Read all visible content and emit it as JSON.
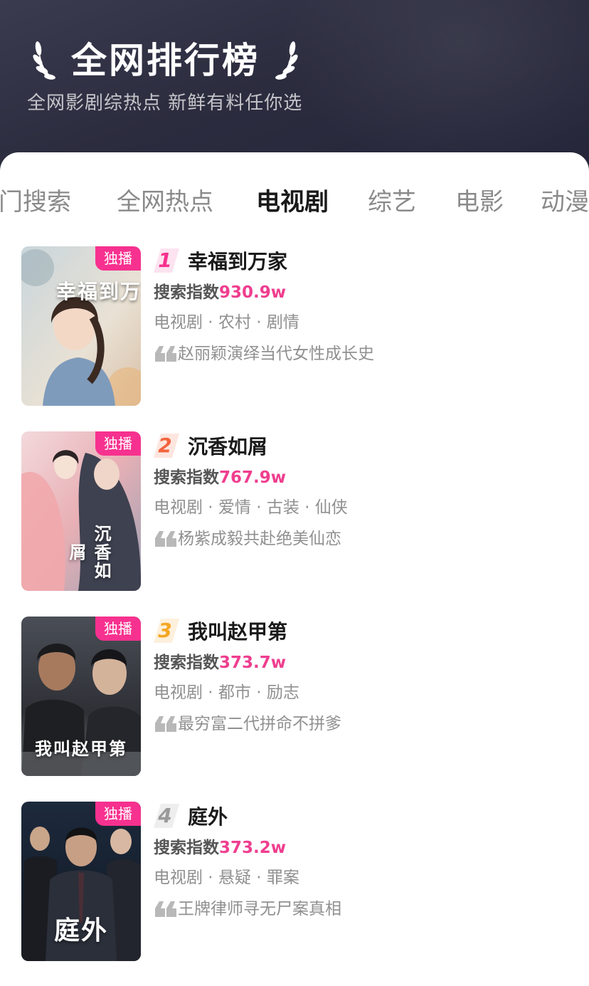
{
  "header": {
    "title": "全网排行榜",
    "subtitle": "全网影剧综热点  新鲜有料任你选"
  },
  "tabs": [
    {
      "label": "热门搜索",
      "active": false
    },
    {
      "label": "全网热点",
      "active": false
    },
    {
      "label": "电视剧",
      "active": true
    },
    {
      "label": "综艺",
      "active": false
    },
    {
      "label": "电影",
      "active": false
    },
    {
      "label": "动漫",
      "active": false
    }
  ],
  "search_prefix": "搜索指数",
  "items": [
    {
      "rank": "1",
      "rank_color": "#f7318f",
      "badge": "独播",
      "title": "幸福到万家",
      "search_index": "930.9w",
      "tags": "电视剧 · 农村 · 剧情",
      "quote": "赵丽颖演绎当代女性成长史",
      "poster_text": "幸福到万家"
    },
    {
      "rank": "2",
      "rank_color": "#f2643d",
      "badge": "独播",
      "title": "沉香如屑",
      "search_index": "767.9w",
      "tags": "电视剧 · 爱情 · 古装 · 仙侠",
      "quote": "杨紫成毅共赴绝美仙恋",
      "poster_text": "沉香如屑"
    },
    {
      "rank": "3",
      "rank_color": "#f5a623",
      "badge": "独播",
      "title": "我叫赵甲第",
      "search_index": "373.7w",
      "tags": "电视剧 · 都市 · 励志",
      "quote": "最穷富二代拼命不拼爹",
      "poster_text": "我叫赵甲第"
    },
    {
      "rank": "4",
      "rank_color": "#9a9a9a",
      "badge": "独播",
      "title": "庭外",
      "search_index": "373.2w",
      "tags": "电视剧 · 悬疑 · 罪案",
      "quote": "王牌律师寻无尸案真相",
      "poster_text": "庭外"
    }
  ],
  "icons": [
    "laurel-left-icon",
    "laurel-right-icon",
    "quote-icon"
  ]
}
